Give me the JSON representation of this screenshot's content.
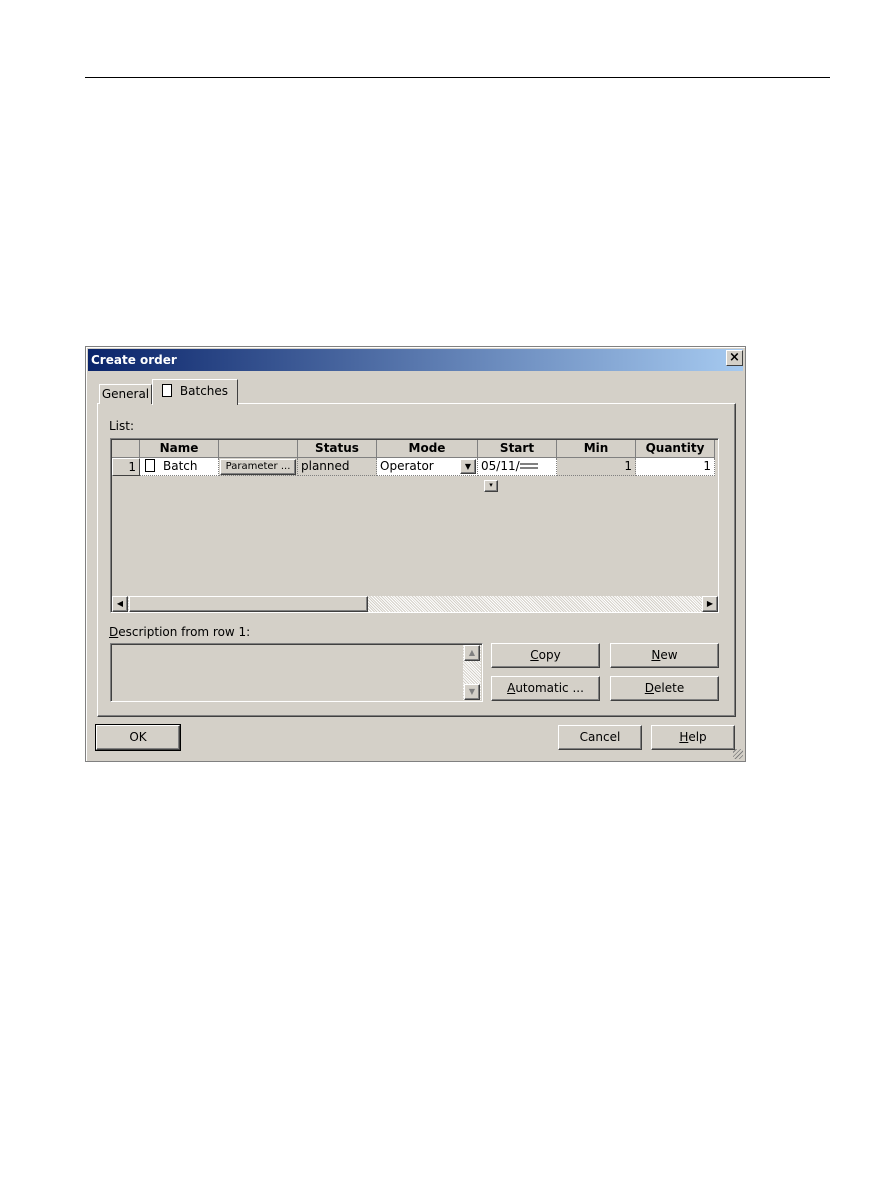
{
  "dialog": {
    "title": "Create order",
    "tabs": [
      {
        "label": "General"
      },
      {
        "label": "Batches",
        "icon": "document-icon",
        "active": true
      }
    ],
    "list_label": "List:",
    "columns": [
      "",
      "Name",
      "",
      "Status",
      "Mode",
      "Start",
      "Min",
      "Quantity"
    ],
    "rows": [
      {
        "index": "1",
        "name": "Batch",
        "parameter_button": "Parameter ...",
        "status": "planned",
        "mode": "Operator",
        "start": "05/11/",
        "min": "1",
        "quantity": "1"
      }
    ],
    "description_label_prefix": "D",
    "description_label_rest": "escription from row 1:",
    "description_value": "",
    "buttons": {
      "copy": {
        "u": "C",
        "rest": "opy"
      },
      "new": {
        "u": "N",
        "rest": "ew"
      },
      "automatic": {
        "u": "A",
        "rest": "utomatic ..."
      },
      "delete": {
        "u": "D",
        "rest": "elete"
      },
      "ok": "OK",
      "cancel": "Cancel",
      "help": {
        "u": "H",
        "rest": "elp"
      }
    },
    "colors": {
      "face": "#d4d0c8",
      "title_start": "#0a246a",
      "title_end": "#a6caf0"
    }
  }
}
